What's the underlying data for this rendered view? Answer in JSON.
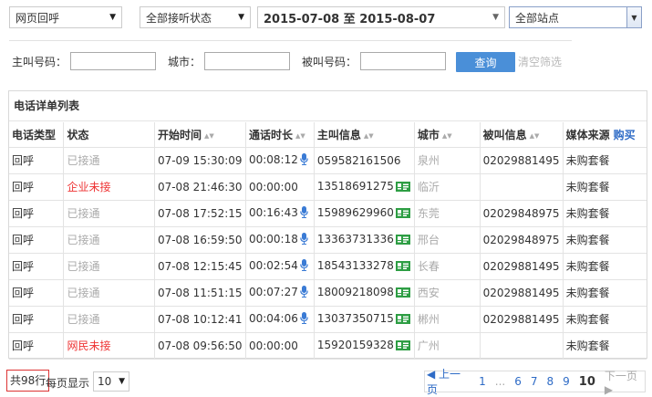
{
  "filters": {
    "call_type": "网页回呼",
    "listen_status": "全部接听状态",
    "date_range": "2015-07-08 至 2015-08-07",
    "site": "全部站点"
  },
  "search": {
    "caller_label": "主叫号码：",
    "city_label": "城市：",
    "callee_label": "被叫号码：",
    "query_button": "查询",
    "clear_link": "清空筛选"
  },
  "table": {
    "title": "电话详单列表",
    "headers": [
      "电话类型",
      "状态",
      "开始时间",
      "通话时长",
      "主叫信息",
      "城市",
      "被叫信息",
      "媒体来源"
    ],
    "buy_link": "购买",
    "rows": [
      {
        "type": "回呼",
        "status": "已接通",
        "status_color": "gray",
        "start": "07-09 15:30:09",
        "duration": "00:08:12",
        "mic": true,
        "caller": "059582161506",
        "card": false,
        "city": "泉州",
        "callee": "02029881495",
        "source": "未购套餐"
      },
      {
        "type": "回呼",
        "status": "企业未接",
        "status_color": "red",
        "start": "07-08 21:46:30",
        "duration": "00:00:00",
        "mic": false,
        "caller": "13518691275",
        "card": true,
        "city": "临沂",
        "callee": "",
        "source": "未购套餐"
      },
      {
        "type": "回呼",
        "status": "已接通",
        "status_color": "gray",
        "start": "07-08 17:52:15",
        "duration": "00:16:43",
        "mic": true,
        "caller": "15989629960",
        "card": true,
        "city": "东莞",
        "callee": "02029848975",
        "source": "未购套餐"
      },
      {
        "type": "回呼",
        "status": "已接通",
        "status_color": "gray",
        "start": "07-08 16:59:50",
        "duration": "00:00:18",
        "mic": true,
        "caller": "13363731336",
        "card": true,
        "city": "邢台",
        "callee": "02029848975",
        "source": "未购套餐"
      },
      {
        "type": "回呼",
        "status": "已接通",
        "status_color": "gray",
        "start": "07-08 12:15:45",
        "duration": "00:02:54",
        "mic": true,
        "caller": "18543133278",
        "card": true,
        "city": "长春",
        "callee": "02029881495",
        "source": "未购套餐"
      },
      {
        "type": "回呼",
        "status": "已接通",
        "status_color": "gray",
        "start": "07-08 11:51:15",
        "duration": "00:07:27",
        "mic": true,
        "caller": "18009218098",
        "card": true,
        "city": "西安",
        "callee": "02029881495",
        "source": "未购套餐"
      },
      {
        "type": "回呼",
        "status": "已接通",
        "status_color": "gray",
        "start": "07-08 10:12:41",
        "duration": "00:04:06",
        "mic": true,
        "caller": "13037350715",
        "card": true,
        "city": "郴州",
        "callee": "02029881495",
        "source": "未购套餐"
      },
      {
        "type": "回呼",
        "status": "网民未接",
        "status_color": "red",
        "start": "07-08 09:56:50",
        "duration": "00:00:00",
        "mic": false,
        "caller": "15920159328",
        "card": true,
        "city": "广州",
        "callee": "",
        "source": "未购套餐"
      }
    ]
  },
  "footer": {
    "total": "共98行",
    "per_page_label": "每页显示",
    "per_page_value": "10",
    "prev": "上一页",
    "pages": [
      "1",
      "...",
      "6",
      "7",
      "8",
      "9",
      "10"
    ],
    "current_page": "10",
    "next": "下一页"
  },
  "colors": {
    "accent": "#4a8fd8",
    "link": "#2e6bc6",
    "missed": "#e33333",
    "connected": "#aaaaaa"
  }
}
